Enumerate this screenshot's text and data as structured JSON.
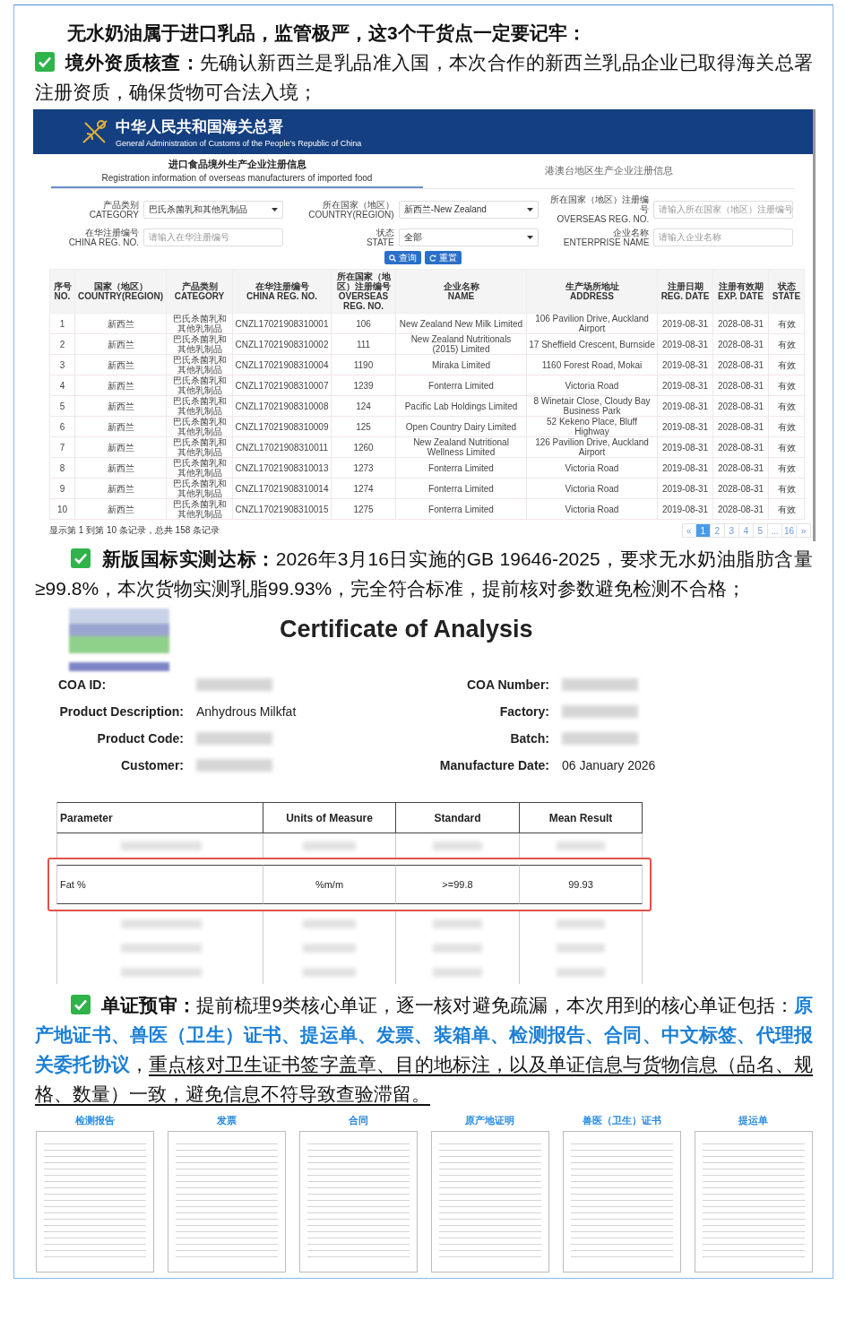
{
  "intro": "无水奶油属于进口乳品，监管极严，这3个干货点一定要记牢：",
  "point_1": {
    "checked": true,
    "segments": [
      {
        "kind": "label",
        "text": "境外资质核查："
      },
      {
        "kind": "plain",
        "text": "先确认新西兰是乳品准入国，本次合作的新西兰乳品企业已取得海关总署注册资质，确保货物可合法入境；"
      }
    ]
  },
  "customs_page": {
    "agency_name": "中华人民共和国海关总署",
    "agency_name_en": "General Administration of Customs of the People's Republic of China",
    "tabs": [
      {
        "label": "进口食品境外生产企业注册信息",
        "sublabel": "Registration information of overseas manufacturers of imported food",
        "selected": true
      },
      {
        "label": "港澳台地区生产企业注册信息",
        "selected": false
      }
    ],
    "filters": [
      {
        "label": "产品类别",
        "label_en": "CATEGORY",
        "kind": "select",
        "value": "巴氏杀菌乳和其他乳制品"
      },
      {
        "label": "所在国家（地区）",
        "label_en": "COUNTRY(REGION)",
        "kind": "select",
        "value": "新西兰-New Zealand"
      },
      {
        "label": "所在国家（地区）注册编号",
        "label_en": "OVERSEAS REG. NO.",
        "kind": "text",
        "placeholder": "请输入所在国家（地区）注册编号"
      },
      {
        "label": "在华注册编号",
        "label_en": "CHINA REG. NO.",
        "kind": "text",
        "placeholder": "请输入在华注册编号"
      },
      {
        "label": "状态",
        "label_en": "STATE",
        "kind": "select",
        "value": "全部"
      },
      {
        "label": "企业名称",
        "label_en": "ENTERPRISE NAME",
        "kind": "text",
        "placeholder": "请输入企业名称"
      }
    ],
    "buttons": [
      {
        "kind": "search",
        "label": "查询"
      },
      {
        "kind": "reset",
        "label": "重置"
      }
    ],
    "columns": [
      {
        "label": "序号",
        "label_en": "NO."
      },
      {
        "label": "国家（地区）",
        "label_en": "COUNTRY(REGION)"
      },
      {
        "label": "产品类别",
        "label_en": "CATEGORY"
      },
      {
        "label": "在华注册编号",
        "label_en": "CHINA REG. NO."
      },
      {
        "label": "所在国家（地区）注册编号",
        "label_en": "OVERSEAS REG. NO."
      },
      {
        "label": "企业名称",
        "label_en": "NAME"
      },
      {
        "label": "生产场所地址",
        "label_en": "ADDRESS"
      },
      {
        "label": "注册日期",
        "label_en": "REG. DATE"
      },
      {
        "label": "注册有效期",
        "label_en": "EXP. DATE"
      },
      {
        "label": "状态",
        "label_en": "STATE"
      }
    ],
    "rows": [
      [
        "1",
        "新西兰",
        "巴氏杀菌乳和其他乳制品",
        "CNZL17021908310001",
        "106",
        "New Zealand New Milk Limited",
        "106 Pavilion Drive, Auckland Airport",
        "2019-08-31",
        "2028-08-31",
        "有效"
      ],
      [
        "2",
        "新西兰",
        "巴氏杀菌乳和其他乳制品",
        "CNZL17021908310002",
        "111",
        "New Zealand Nutritionals (2015) Limited",
        "17 Sheffield Crescent, Burnside",
        "2019-08-31",
        "2028-08-31",
        "有效"
      ],
      [
        "3",
        "新西兰",
        "巴氏杀菌乳和其他乳制品",
        "CNZL17021908310004",
        "1190",
        "Miraka Limited",
        "1160 Forest Road, Mokai",
        "2019-08-31",
        "2028-08-31",
        "有效"
      ],
      [
        "4",
        "新西兰",
        "巴氏杀菌乳和其他乳制品",
        "CNZL17021908310007",
        "1239",
        "Fonterra Limited",
        "Victoria Road",
        "2019-08-31",
        "2028-08-31",
        "有效"
      ],
      [
        "5",
        "新西兰",
        "巴氏杀菌乳和其他乳制品",
        "CNZL17021908310008",
        "124",
        "Pacific Lab Holdings Limited",
        "8 Winetair Close, Cloudy Bay Business Park",
        "2019-08-31",
        "2028-08-31",
        "有效"
      ],
      [
        "6",
        "新西兰",
        "巴氏杀菌乳和其他乳制品",
        "CNZL17021908310009",
        "125",
        "Open Country Dairy Limited",
        "52 Kekeno Place, Bluff Highway",
        "2019-08-31",
        "2028-08-31",
        "有效"
      ],
      [
        "7",
        "新西兰",
        "巴氏杀菌乳和其他乳制品",
        "CNZL17021908310011",
        "1260",
        "New Zealand Nutritional Wellness Limited",
        "126 Pavilion Drive, Auckland Airport",
        "2019-08-31",
        "2028-08-31",
        "有效"
      ],
      [
        "8",
        "新西兰",
        "巴氏杀菌乳和其他乳制品",
        "CNZL17021908310013",
        "1273",
        "Fonterra Limited",
        "Victoria Road",
        "2019-08-31",
        "2028-08-31",
        "有效"
      ],
      [
        "9",
        "新西兰",
        "巴氏杀菌乳和其他乳制品",
        "CNZL17021908310014",
        "1274",
        "Fonterra Limited",
        "Victoria Road",
        "2019-08-31",
        "2028-08-31",
        "有效"
      ],
      [
        "10",
        "新西兰",
        "巴氏杀菌乳和其他乳制品",
        "CNZL17021908310015",
        "1275",
        "Fonterra Limited",
        "Victoria Road",
        "2019-08-31",
        "2028-08-31",
        "有效"
      ]
    ],
    "record_summary": "显示第 1 到第 10 条记录，总共 158 条记录",
    "pages": [
      {
        "label": "«",
        "selected": false
      },
      {
        "label": "1",
        "selected": true
      },
      {
        "label": "2",
        "selected": false
      },
      {
        "label": "3",
        "selected": false
      },
      {
        "label": "4",
        "selected": false
      },
      {
        "label": "5",
        "selected": false
      },
      {
        "label": "...",
        "selected": false
      },
      {
        "label": "16",
        "selected": false
      },
      {
        "label": "»",
        "selected": false
      }
    ]
  },
  "point_2": {
    "checked": true,
    "segments": [
      {
        "kind": "label",
        "text": "新版国标实测达标："
      },
      {
        "kind": "plain",
        "text": "2026年3月16日实施的GB 19646-2025，要求无水奶油脂肪含量≥99.8%，本次货物实测乳脂99.93%，完全符合标准，提前核对参数避免检测不合格；"
      }
    ]
  },
  "coa": {
    "title": "Certificate of Analysis",
    "fields": [
      {
        "label": "COA ID:",
        "kind": "redacted"
      },
      {
        "label": "COA Number:",
        "kind": "redacted"
      },
      {
        "label": "Product Description:",
        "kind": "text",
        "value": "Anhydrous Milkfat"
      },
      {
        "label": "Factory:",
        "kind": "redacted"
      },
      {
        "label": "Product Code:",
        "kind": "redacted"
      },
      {
        "label": "Batch:",
        "kind": "redacted"
      },
      {
        "label": "Customer:",
        "kind": "redacted"
      },
      {
        "label": "Manufacture Date:",
        "kind": "text",
        "value": "06 January 2026"
      }
    ],
    "columns": [
      "Parameter",
      "Units of Measure",
      "Standard",
      "Mean Result"
    ],
    "rows": [
      {
        "kind": "redacted",
        "highlighted": false
      },
      {
        "kind": "text",
        "highlighted": true,
        "cells": [
          "Fat %",
          "%m/m",
          ">=99.8",
          "99.93"
        ]
      },
      {
        "kind": "redacted",
        "highlighted": false
      },
      {
        "kind": "redacted",
        "highlighted": false
      },
      {
        "kind": "redacted",
        "highlighted": false
      }
    ]
  },
  "point_3": {
    "checked": true,
    "segments": [
      {
        "kind": "label",
        "text": "单证预审："
      },
      {
        "kind": "plain",
        "text": "提前梳理9类核心单证，逐一核对避免疏漏，本次用到的核心单证包括："
      },
      {
        "kind": "highlight",
        "text": "原产地证书、兽医（卫生）证书、提运单、发票、装箱单、检测报告、合同、中文标签、代理报关委托协议"
      },
      {
        "kind": "plain",
        "text": "，"
      },
      {
        "kind": "underline",
        "text": "重点核对卫生证书签字盖章、目的地标注，以及单证信息与货物信息（品名、规格、数量）一致，避免信息不符导致查验滞留。"
      }
    ]
  },
  "documents": [
    {
      "label": "检测报告"
    },
    {
      "label": "发票"
    },
    {
      "label": "合同"
    },
    {
      "label": "原产地证明"
    },
    {
      "label": "兽医（卫生）证书"
    },
    {
      "label": "提运单"
    }
  ]
}
